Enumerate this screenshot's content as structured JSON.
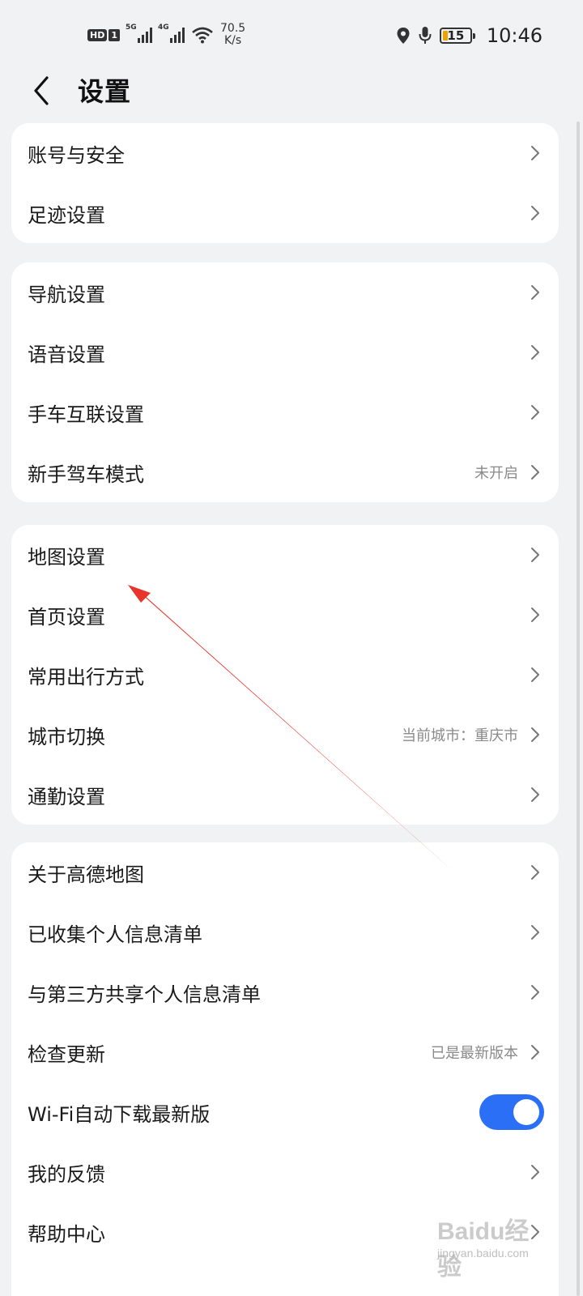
{
  "status_bar": {
    "hd": "HD",
    "sim": "1",
    "net1": "5G",
    "net2": "4G",
    "speed_value": "70.5",
    "speed_unit": "K/s",
    "battery": "15",
    "time": "10:46"
  },
  "header": {
    "title": "设置"
  },
  "groups": [
    {
      "items": [
        {
          "label": "账号与安全"
        },
        {
          "label": "足迹设置"
        }
      ]
    },
    {
      "items": [
        {
          "label": "导航设置"
        },
        {
          "label": "语音设置"
        },
        {
          "label": "手车互联设置"
        },
        {
          "label": "新手驾车模式",
          "value": "未开启"
        }
      ]
    },
    {
      "items": [
        {
          "label": "地图设置"
        },
        {
          "label": "首页设置"
        },
        {
          "label": "常用出行方式"
        },
        {
          "label": "城市切换",
          "value": "当前城市：重庆市"
        },
        {
          "label": "通勤设置"
        }
      ]
    },
    {
      "items": [
        {
          "label": "关于高德地图"
        },
        {
          "label": "已收集个人信息清单"
        },
        {
          "label": "与第三方共享个人信息清单"
        },
        {
          "label": "检查更新",
          "value": "已是最新版本"
        },
        {
          "label": "Wi-Fi自动下载最新版",
          "toggle_on": true
        },
        {
          "label": "我的反馈"
        },
        {
          "label": "帮助中心"
        }
      ]
    }
  ],
  "watermark": {
    "brand": "Baidu经验",
    "url": "jingyan.baidu.com"
  },
  "colors": {
    "toggle_on": "#2a6ff5",
    "annotation_arrow": "#e8342a",
    "background": "#f1f2f4"
  }
}
